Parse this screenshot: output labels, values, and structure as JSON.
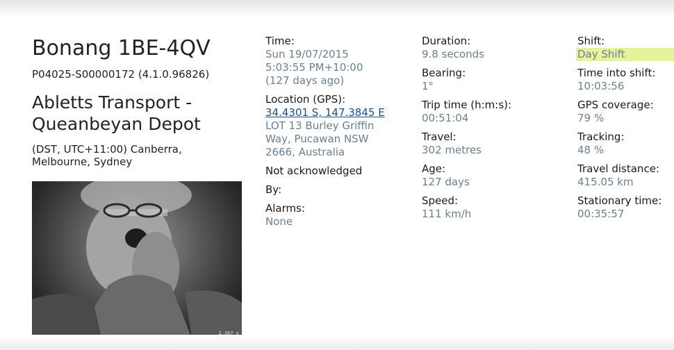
{
  "vehicle": {
    "title": "Bonang 1BE-4QV",
    "serial": "P04025-S00000172 (4.1.0.96826)",
    "company_line1": "Abletts Transport -",
    "company_line2": "Queanbeyan Depot",
    "timezone_line1": "(DST, UTC+11:00) Canberra,",
    "timezone_line2": "Melbourne, Sydney"
  },
  "photo": {
    "stamp": "2.367 s"
  },
  "event": {
    "time_label": "Time:",
    "time_line1": "Sun 19/07/2015",
    "time_line2": "5:03:55 PM+10:00",
    "time_line3": "(127 days ago)",
    "location_label": "Location (GPS):",
    "location_coords": "34.4301 S, 147.3845 E",
    "address_line1": "LOT 13 Burley Griffin",
    "address_line2": "Way, Pucawan NSW",
    "address_line3": "2666, Australia",
    "ack_status": "Not acknowledged",
    "by_label": "By:",
    "alarms_label": "Alarms:",
    "alarms_value": "None"
  },
  "trip": {
    "duration_label": "Duration:",
    "duration_value": "9.8 seconds",
    "bearing_label": "Bearing:",
    "bearing_value": "1°",
    "trip_time_label": "Trip time (h:m:s):",
    "trip_time_value": "00:51:04",
    "travel_label": "Travel:",
    "travel_value": "302 metres",
    "age_label": "Age:",
    "age_value": "127 days",
    "speed_label": "Speed:",
    "speed_value": "111 km/h"
  },
  "shift": {
    "shift_label": "Shift:",
    "shift_value": "Day Shift",
    "time_into_label": "Time into shift:",
    "time_into_value": "10:03:56",
    "gps_label": "GPS coverage:",
    "gps_value": "79 %",
    "tracking_label": "Tracking:",
    "tracking_value": "48 %",
    "distance_label": "Travel distance:",
    "distance_value": "415.05 km",
    "stationary_label": "Stationary time:",
    "stationary_value": "00:35:57"
  },
  "colors": {
    "label": "#1a1a1a",
    "value": "#6b7f93",
    "link": "#1f4e8a",
    "highlight": "#e6f29c"
  }
}
